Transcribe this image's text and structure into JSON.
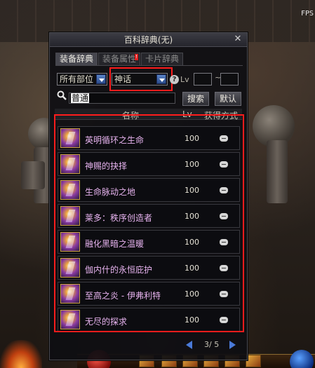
{
  "hud": {
    "fps_label": "FPS"
  },
  "dialog": {
    "title": "百科辞典(无)",
    "close_label": "✕",
    "tabs": [
      {
        "label": "装备辞典",
        "active": true
      },
      {
        "label": "装备属性",
        "active": false
      },
      {
        "label": "卡片辞典",
        "active": false
      }
    ],
    "filters": {
      "slot_select": "所有部位",
      "rarity_select": "神话",
      "level_label": "Lv",
      "level_separator": "~"
    },
    "search": {
      "value": "普通",
      "search_button": "搜索",
      "default_button": "默认"
    },
    "list_header": {
      "name": "名称",
      "level": "Lv",
      "source": "获得方式"
    },
    "rows": [
      {
        "name": "英明循环之生命",
        "level": "100"
      },
      {
        "name": "神赐的抉择",
        "level": "100"
      },
      {
        "name": "生命脉动之地",
        "level": "100"
      },
      {
        "name": "莱多：秩序创造者",
        "level": "100"
      },
      {
        "name": "融化黑暗之温暖",
        "level": "100"
      },
      {
        "name": "伽内什的永恒庇护",
        "level": "100"
      },
      {
        "name": "至高之炎 - 伊弗利特",
        "level": "100"
      },
      {
        "name": "无尽的探求",
        "level": "100"
      }
    ],
    "pager": {
      "text": "3/ 5"
    }
  },
  "colors": {
    "highlight_frame": "#ff1c1c",
    "item_name": "#e8b4f0",
    "pager_arrow": "#4a7ad8"
  }
}
